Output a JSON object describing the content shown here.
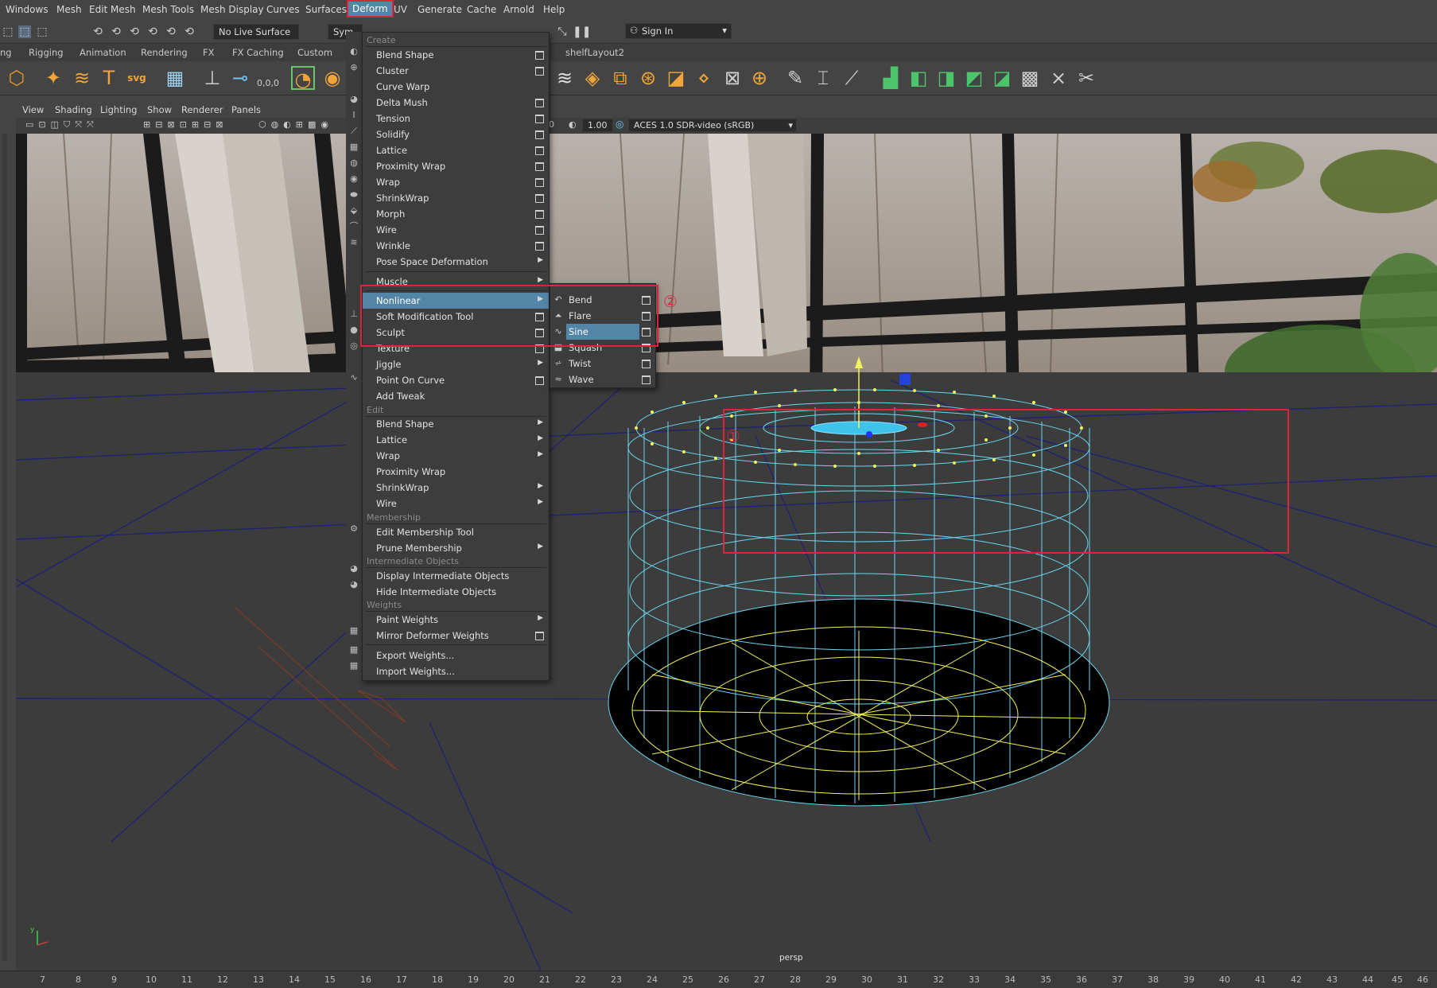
{
  "menubar": {
    "items": [
      "Windows",
      "Mesh",
      "Edit Mesh",
      "Mesh Tools",
      "Mesh Display",
      "Curves",
      "Surfaces",
      "Deform",
      "UV",
      "Generate",
      "Cache",
      "Arnold",
      "Help"
    ],
    "active": "Deform"
  },
  "statusline": {
    "live_surface": "No Live Surface",
    "symmetry": "Sym",
    "sign_in": "Sign In"
  },
  "shelf": {
    "tabs": [
      "ng",
      "Rigging",
      "Animation",
      "Rendering",
      "FX",
      "FX Caching",
      "Custom",
      "shelfLayout2"
    ],
    "coord_readout": "0,0,0"
  },
  "panel": {
    "menus": [
      "View",
      "Shading",
      "Lighting",
      "Show",
      "Renderer",
      "Panels"
    ],
    "exposure_value": "1.00",
    "exposure_prefix": "0",
    "color_space": "ACES 1.0 SDR-video (sRGB)",
    "camera_label": "persp"
  },
  "deform_menu": {
    "sections": {
      "create": "Create",
      "edit": "Edit",
      "membership": "Membership",
      "intermediate": "Intermediate Objects",
      "weights": "Weights"
    },
    "items": {
      "blend_shape": "Blend Shape",
      "cluster": "Cluster",
      "curve_warp": "Curve Warp",
      "delta_mush": "Delta Mush",
      "tension": "Tension",
      "solidify": "Solidify",
      "lattice": "Lattice",
      "proximity_wrap": "Proximity Wrap",
      "wrap": "Wrap",
      "shrinkwrap": "ShrinkWrap",
      "morph": "Morph",
      "wire": "Wire",
      "wrinkle": "Wrinkle",
      "pose_space": "Pose Space Deformation",
      "muscle": "Muscle",
      "nonlinear": "Nonlinear",
      "soft_mod": "Soft Modification Tool",
      "sculpt": "Sculpt",
      "texture": "Texture",
      "jiggle": "Jiggle",
      "point_on_curve": "Point On Curve",
      "add_tweak": "Add Tweak",
      "edit_blend_shape": "Blend Shape",
      "edit_lattice": "Lattice",
      "edit_wrap": "Wrap",
      "edit_proximity_wrap": "Proximity Wrap",
      "edit_shrinkwrap": "ShrinkWrap",
      "edit_wire": "Wire",
      "edit_membership": "Edit Membership Tool",
      "prune_membership": "Prune Membership",
      "display_intermediate": "Display Intermediate Objects",
      "hide_intermediate": "Hide Intermediate Objects",
      "paint_weights": "Paint Weights",
      "mirror_weights": "Mirror Deformer Weights",
      "export_weights": "Export Weights...",
      "import_weights": "Import Weights..."
    }
  },
  "nonlinear_submenu": {
    "items": [
      "Bend",
      "Flare",
      "Sine",
      "Squash",
      "Twist",
      "Wave"
    ],
    "highlighted": "Sine"
  },
  "annotations": {
    "callout_1": "①",
    "callout_2": "②"
  },
  "timeline": {
    "ticks": [
      "7",
      "8",
      "9",
      "10",
      "11",
      "12",
      "13",
      "14",
      "15",
      "16",
      "17",
      "18",
      "19",
      "20",
      "21",
      "22",
      "23",
      "24",
      "25",
      "26",
      "27",
      "28",
      "29",
      "30",
      "31",
      "32",
      "33",
      "34",
      "35",
      "36",
      "37",
      "38",
      "39",
      "40",
      "41",
      "42",
      "43",
      "44",
      "45",
      "46"
    ]
  },
  "colors": {
    "highlight": "#5285a6",
    "annotation_red": "#d8263a",
    "wireframe": "#6ad6f0",
    "vertex_yellow": "#f3f35a"
  }
}
